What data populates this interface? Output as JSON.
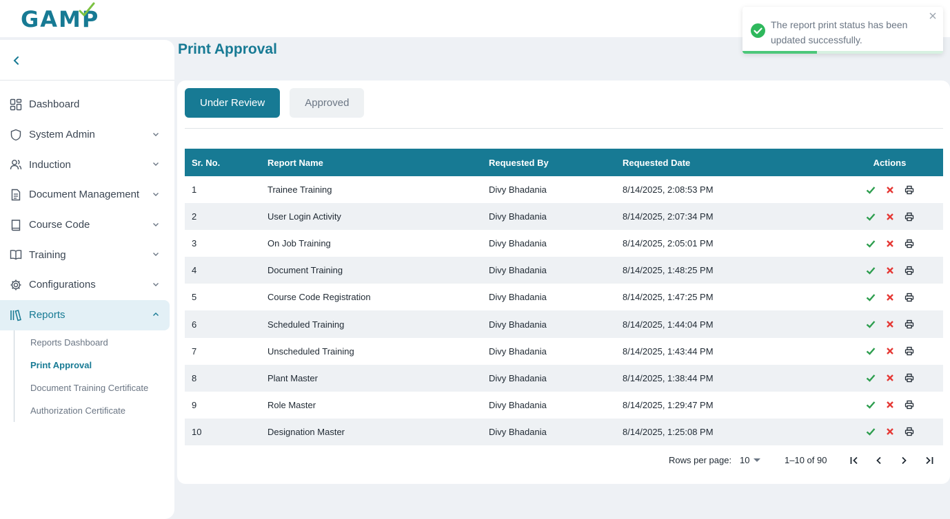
{
  "brand": {
    "logo": "GAMP",
    "color": "#177a94"
  },
  "sidebar": {
    "collapse_icon": "chevron-left-icon",
    "items": [
      {
        "label": "Dashboard",
        "icon": "grid-icon",
        "expandable": false
      },
      {
        "label": "System Admin",
        "icon": "shield-icon",
        "expandable": true
      },
      {
        "label": "Induction",
        "icon": "users-icon",
        "expandable": true
      },
      {
        "label": "Document Management",
        "icon": "document-icon",
        "expandable": true
      },
      {
        "label": "Course Code",
        "icon": "book-icon",
        "expandable": true
      },
      {
        "label": "Training",
        "icon": "open-book-icon",
        "expandable": true
      },
      {
        "label": "Configurations",
        "icon": "settings-icon",
        "expandable": true
      },
      {
        "label": "Reports",
        "icon": "library-icon",
        "expandable": true,
        "expanded": true
      }
    ],
    "reports_sub": [
      {
        "label": "Reports Dashboard"
      },
      {
        "label": "Print Approval",
        "active": true
      },
      {
        "label": "Document Training Certificate"
      },
      {
        "label": "Authorization Certificate"
      }
    ]
  },
  "page": {
    "title": "Print Approval"
  },
  "tabs": [
    {
      "label": "Under Review",
      "active": true
    },
    {
      "label": "Approved",
      "active": false
    }
  ],
  "table": {
    "columns": [
      "Sr. No.",
      "Report Name",
      "Requested By",
      "Requested Date",
      "Actions"
    ],
    "rows": [
      {
        "sr": "1",
        "name": "Trainee Training",
        "by": "Divy Bhadania",
        "date": "8/14/2025, 2:08:53 PM"
      },
      {
        "sr": "2",
        "name": "User Login Activity",
        "by": "Divy Bhadania",
        "date": "8/14/2025, 2:07:34 PM"
      },
      {
        "sr": "3",
        "name": "On Job Training",
        "by": "Divy Bhadania",
        "date": "8/14/2025, 2:05:01 PM"
      },
      {
        "sr": "4",
        "name": "Document Training",
        "by": "Divy Bhadania",
        "date": "8/14/2025, 1:48:25 PM"
      },
      {
        "sr": "5",
        "name": "Course Code Registration",
        "by": "Divy Bhadania",
        "date": "8/14/2025, 1:47:25 PM"
      },
      {
        "sr": "6",
        "name": "Scheduled Training",
        "by": "Divy Bhadania",
        "date": "8/14/2025, 1:44:04 PM"
      },
      {
        "sr": "7",
        "name": "Unscheduled Training",
        "by": "Divy Bhadania",
        "date": "8/14/2025, 1:43:44 PM"
      },
      {
        "sr": "8",
        "name": "Plant Master",
        "by": "Divy Bhadania",
        "date": "8/14/2025, 1:38:44 PM"
      },
      {
        "sr": "9",
        "name": "Role Master",
        "by": "Divy Bhadania",
        "date": "8/14/2025, 1:29:47 PM"
      },
      {
        "sr": "10",
        "name": "Designation Master",
        "by": "Divy Bhadania",
        "date": "8/14/2025, 1:25:08 PM"
      }
    ],
    "action_icons": [
      "check-icon",
      "close-icon",
      "printer-icon"
    ],
    "colors": {
      "header": "#177a94",
      "approve": "#2e9e4f",
      "reject": "#e53935"
    }
  },
  "pagination": {
    "rows_per_page_label": "Rows per page:",
    "rows_per_page_value": "10",
    "range": "1–10 of 90"
  },
  "toast": {
    "message": "The report print status has been updated successfully.",
    "status": "success",
    "progress": 0.37,
    "color": "#4cc77a"
  }
}
